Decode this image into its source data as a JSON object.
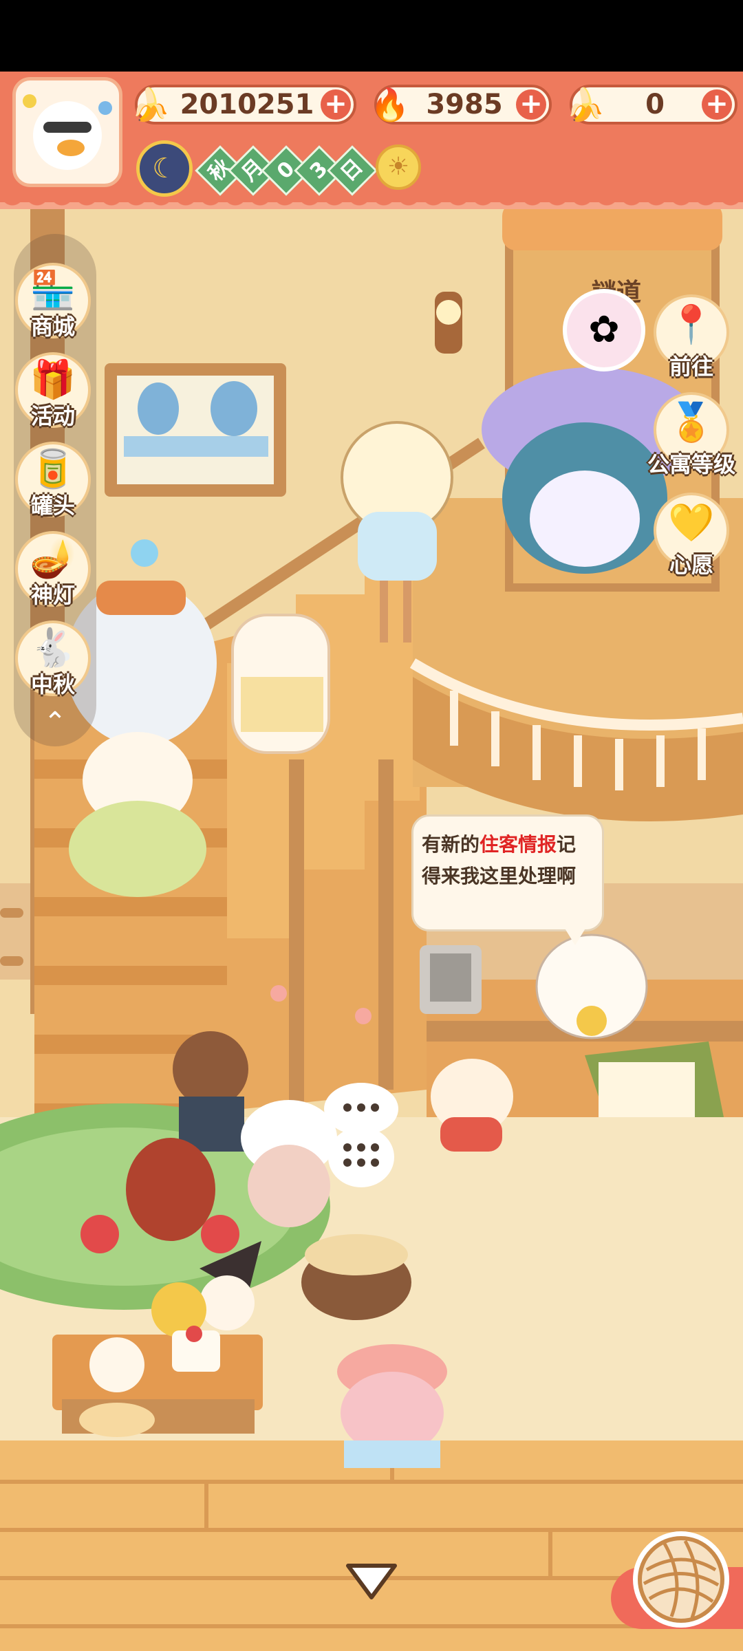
{
  "hud": {
    "currencies": [
      {
        "name": "banana",
        "value": "2010251",
        "icon": "banana-icon"
      },
      {
        "name": "flame",
        "value": "3985",
        "icon": "blue-flame-icon"
      },
      {
        "name": "blue-banana",
        "value": "0",
        "icon": "blue-banana-icon"
      }
    ],
    "date": {
      "chars": [
        "秋",
        "月",
        "0",
        "3",
        "日"
      ],
      "weather_icon": "sun-icon",
      "moon_icon": "moon-clock-icon"
    }
  },
  "left_menu": [
    {
      "label": "商城",
      "icon": "shop-icon"
    },
    {
      "label": "活动",
      "icon": "gift-icon"
    },
    {
      "label": "罐头",
      "icon": "can-icon"
    },
    {
      "label": "神灯",
      "icon": "magic-lamp-icon"
    },
    {
      "label": "中秋",
      "icon": "mooncake-rabbit-icon"
    }
  ],
  "right_menu": [
    {
      "label": "前往",
      "icon": "map-pin-icon"
    },
    {
      "label": "公寓等级",
      "icon": "cat-badge-icon"
    },
    {
      "label": "心愿",
      "icon": "heart-book-icon"
    }
  ],
  "signboard": "謎道",
  "speech": {
    "before": "有新的",
    "highlight": "住客情报",
    "after_line1": "记",
    "line2": "得来我这里处理啊"
  },
  "colors": {
    "hud": "#ee7a5d",
    "wood": "#e9b36a",
    "rug": "#8cc06a",
    "highlight": "#e02424"
  }
}
